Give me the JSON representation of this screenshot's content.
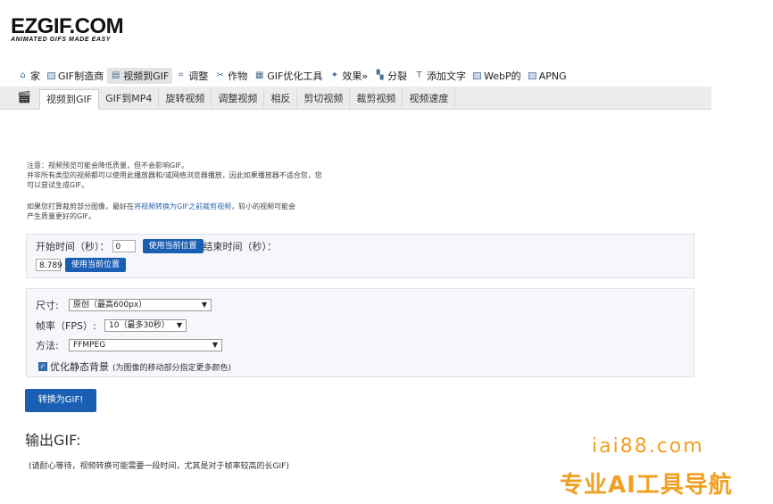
{
  "logo": {
    "main": "EZGIF.COM",
    "sub": "ANIMATED GIFS MADE EASY"
  },
  "main_nav": [
    {
      "icon": "home-icon",
      "glyph": "⌂",
      "label": "家"
    },
    {
      "icon": "image-icon",
      "glyph": "",
      "label": "GIF制造商"
    },
    {
      "icon": "video-icon",
      "glyph": "▤",
      "label": "视频到GIF",
      "active": true
    },
    {
      "icon": "resize-icon",
      "glyph": "⌗",
      "label": "调整"
    },
    {
      "icon": "crop-icon",
      "glyph": "✂",
      "label": "作物"
    },
    {
      "icon": "optimize-icon",
      "glyph": "▦",
      "label": "GIF优化工具"
    },
    {
      "icon": "effects-icon",
      "glyph": "✦",
      "label": "效果»"
    },
    {
      "icon": "split-icon",
      "glyph": "▚",
      "label": "分裂"
    },
    {
      "icon": "text-icon",
      "glyph": "T",
      "label": "添加文字"
    },
    {
      "icon": "webp-icon",
      "glyph": "",
      "label": "WebP的"
    },
    {
      "icon": "apng-icon",
      "glyph": "",
      "label": "APNG"
    }
  ],
  "sub_nav": [
    "视频到GIF",
    "GIF到MP4",
    "旋转视频",
    "调整视频",
    "相反",
    "剪切视频",
    "裁剪视频",
    "视频速度"
  ],
  "notes": {
    "line1": "注意：视频预览可能会降低质量，但不会影响GIF。",
    "line2": "并非所有类型的视频都可以使用此播放器和/或网络浏览器播放，因此如果播放器不适合您，您",
    "line3": "可以尝试生成GIF。",
    "p2_a": "如果您打算裁剪部分图像，最好在",
    "p2_link1": "将视频转换为GIF之前裁剪视频",
    "p2_b": "，较小的视频可能会",
    "p2_c": "产生质量更好的GIF。"
  },
  "time": {
    "start_label": "开始时间（秒）：",
    "start_value": "0",
    "use_current_start": "使用当前位置",
    "end_label": "结束时间（秒）：",
    "end_value": "8.789",
    "use_current_end": "使用当前位置"
  },
  "options": {
    "size_label": "尺寸:",
    "size_value": "原创（最高600px）",
    "fps_label": "帧率（FPS）:",
    "fps_value": "10（最多30秒）",
    "method_label": "方法:",
    "method_value": "FFMPEG",
    "optimize_label": "优化静态背景",
    "optimize_hint": "(为图像的移动部分指定更多颜色)",
    "optimize_checked": true
  },
  "convert_button": "转换为GIF!",
  "output": {
    "title": "输出GIF:",
    "note": "(请耐心等待，视频转换可能需要一段时间，尤其是对于帧率较高的长GIF)"
  },
  "watermark": {
    "line1": "iai88.com",
    "line2": "专业AI工具导航",
    "color": "#f0a024"
  }
}
